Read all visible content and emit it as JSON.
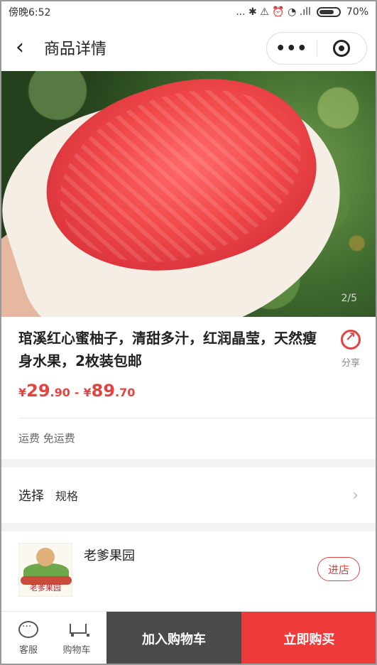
{
  "status_bar": {
    "time": "傍晚6:52",
    "icons": "... ✱ ⚠ ⏰ ◔ .ıll",
    "battery": "70%"
  },
  "nav": {
    "title": "商品详情",
    "back_icon": "chevron-left-icon",
    "more_label": "•••"
  },
  "hero": {
    "counter": "2/5"
  },
  "product": {
    "title": "琯溪红心蜜柚子，清甜多汁，红润晶莹，天然瘦身水果，2枚装包邮",
    "share_label": "分享",
    "price": {
      "symbol": "¥",
      "min_int": "29",
      "min_dec": ".90",
      "dash": "-",
      "max_int": "89",
      "max_dec": ".70"
    },
    "shipping": "运费 免运费"
  },
  "spec": {
    "key": "选择",
    "value": "规格",
    "chevron": "›"
  },
  "store": {
    "name": "老爹果园",
    "logo_text": "老爹果园",
    "enter_label": "进店"
  },
  "bottom_bar": {
    "service_label": "客服",
    "cart_label": "购物车",
    "add_to_cart": "加入购物车",
    "buy_now": "立即购买"
  },
  "colors": {
    "accent": "#e64340",
    "buy": "#ef3a3a",
    "cart_button": "#4a4a4a"
  }
}
